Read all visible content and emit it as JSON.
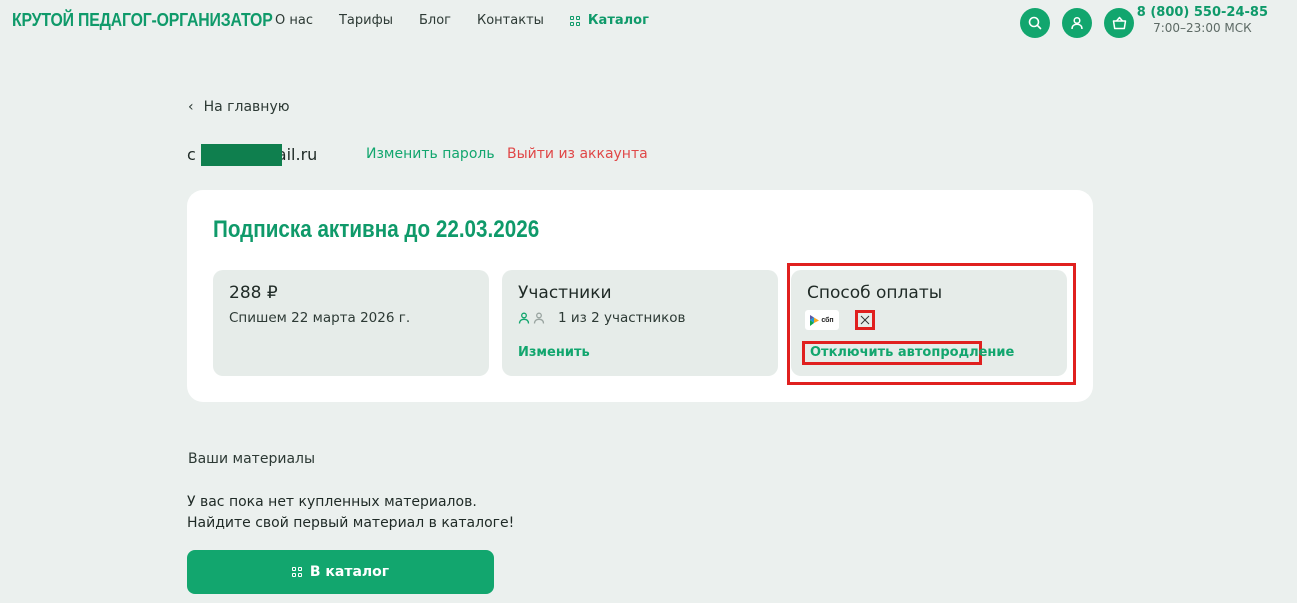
{
  "header": {
    "logo": "КРУТОЙ ПЕДАГОГ-ОРГАНИЗАТОР",
    "nav": [
      {
        "label": "О нас"
      },
      {
        "label": "Тарифы"
      },
      {
        "label": "Блог"
      },
      {
        "label": "Контакты"
      }
    ],
    "catalog_label": "Каталог",
    "icons": [
      "search-icon",
      "user-icon",
      "basket-icon"
    ],
    "phone": "8 (800) 550-24-85",
    "hours": "7:00–23:00 МСК"
  },
  "back_link": "На главную",
  "account": {
    "email_prefix": "c",
    "email_suffix": "ail.ru",
    "change_password": "Изменить пароль",
    "logout": "Выйти из аккаунта"
  },
  "subscription": {
    "title": "Подписка активна до 22.03.2026",
    "price_tile": {
      "title": "288 ₽",
      "subtitle": "Спишем 22 марта 2026 г."
    },
    "members_tile": {
      "title": "Участники",
      "count_text": "1 из 2 участников",
      "members_filled": 1,
      "members_total": 2,
      "link": "Изменить"
    },
    "payment_tile": {
      "title": "Способ оплаты",
      "method": "сбп",
      "cancel_link": "Отключить автопродление"
    }
  },
  "materials": {
    "label": "Ваши материалы",
    "empty_line1": "У вас пока нет купленных материалов.",
    "empty_line2": "Найдите свой первый материал в каталоге!",
    "button": "В каталог"
  },
  "colors": {
    "brand": "#12a66e",
    "danger": "#e04848",
    "highlight": "#e0201f",
    "background": "#ebf0ee"
  }
}
